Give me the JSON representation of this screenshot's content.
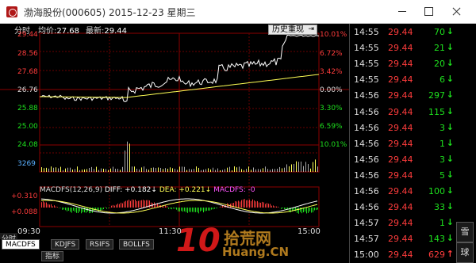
{
  "window": {
    "title": "渤海股份(000605) 2015-12-23 星期三"
  },
  "chart_header": {
    "time_label": "分时",
    "avg_label": "均价:",
    "avg_value": "27.68",
    "last_label": "最新:",
    "last_value": "29.44",
    "history_button": "历史重现",
    "history_pin": "⇥"
  },
  "left_axis": [
    "29.44",
    "28.56",
    "27.68",
    "26.76",
    "25.88",
    "25.00",
    "24.08",
    "3269",
    "+0.310",
    "+0.088"
  ],
  "right_axis": [
    "10.01%",
    "6.72%",
    "3.42%",
    "0.00%",
    "3.30%",
    "6.59%",
    "10.01%"
  ],
  "x_axis": [
    "09:30",
    "11:30",
    "15:00"
  ],
  "macd_header": {
    "name": "MACDFS(12,26,9)",
    "diff": "DIFF: +0.182↓",
    "dea": "DEA: +0.221↓",
    "mfs": "MACDFS: -0"
  },
  "side_labels": {
    "time_share": "分时重",
    "indicator": "指标"
  },
  "tabs": [
    "MACDFS",
    "KDJFS",
    "RSIFS",
    "BOLLFS"
  ],
  "watermark": {
    "num": "10",
    "cn": "拾荒网",
    "en": "Huang.CN"
  },
  "ticks": [
    {
      "time": "14:55",
      "price": "29.44",
      "vol": "70",
      "dir": "down"
    },
    {
      "time": "14:55",
      "price": "29.44",
      "vol": "21",
      "dir": "down"
    },
    {
      "time": "14:55",
      "price": "29.44",
      "vol": "20",
      "dir": "down"
    },
    {
      "time": "14:55",
      "price": "29.44",
      "vol": "6",
      "dir": "down"
    },
    {
      "time": "14:56",
      "price": "29.44",
      "vol": "297",
      "dir": "down"
    },
    {
      "time": "14:56",
      "price": "29.44",
      "vol": "115",
      "dir": "down"
    },
    {
      "time": "14:56",
      "price": "29.44",
      "vol": "3",
      "dir": "down"
    },
    {
      "time": "14:56",
      "price": "29.44",
      "vol": "1",
      "dir": "down"
    },
    {
      "time": "14:56",
      "price": "29.44",
      "vol": "3",
      "dir": "down"
    },
    {
      "time": "14:56",
      "price": "29.44",
      "vol": "5",
      "dir": "down"
    },
    {
      "time": "14:56",
      "price": "29.44",
      "vol": "100",
      "dir": "down"
    },
    {
      "time": "14:56",
      "price": "29.44",
      "vol": "33",
      "dir": "down"
    },
    {
      "time": "14:57",
      "price": "29.44",
      "vol": "1",
      "dir": "down"
    },
    {
      "time": "14:57",
      "price": "29.44",
      "vol": "143",
      "dir": "down"
    },
    {
      "time": "15:00",
      "price": "29.44",
      "vol": "629",
      "dir": "up"
    }
  ],
  "side_strip": {
    "num": "",
    "tab1": "雪",
    "tab2": "球"
  }
}
